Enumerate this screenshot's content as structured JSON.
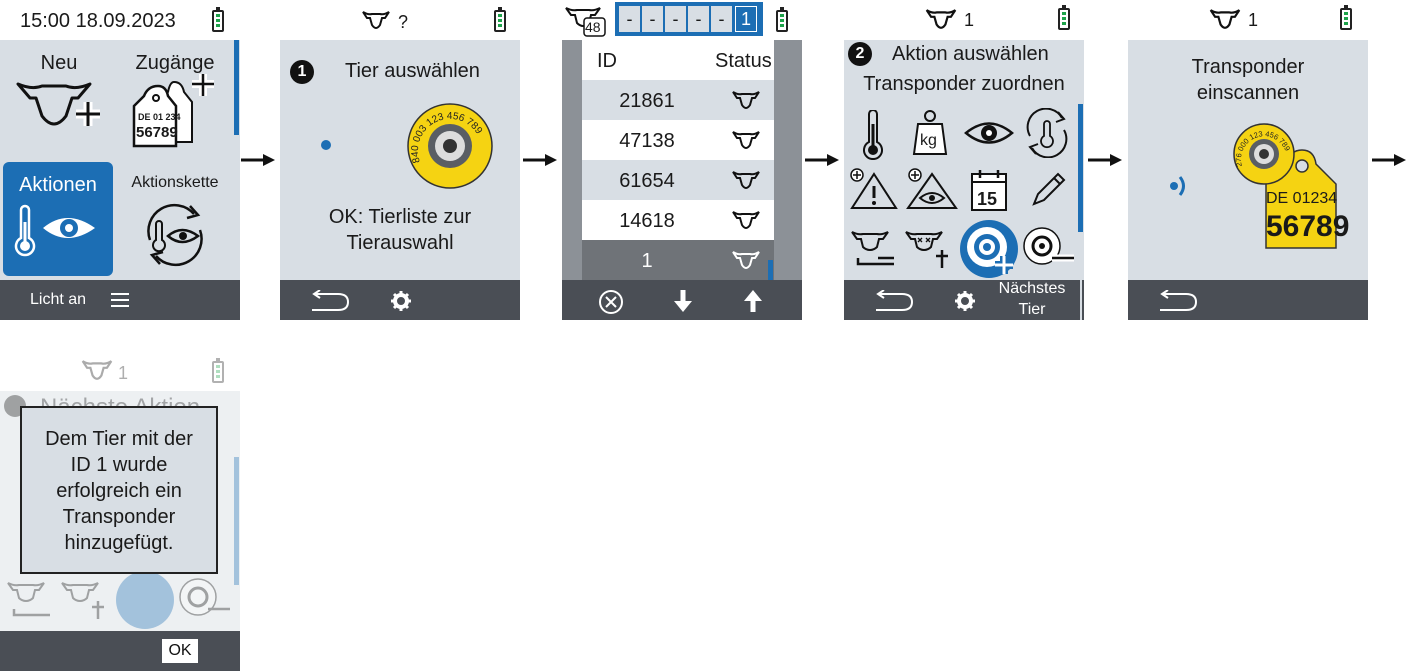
{
  "screen1": {
    "datetime": "15:00 18.09.2023",
    "neu": "Neu",
    "zugaenge": "Zugänge",
    "tag_line1": "DE 01 234",
    "tag_line2": "56789",
    "aktionen": "Aktionen",
    "aktionskette": "Aktionskette",
    "footer_label": "Licht an"
  },
  "screen2": {
    "animal_id": "?",
    "step": "1",
    "title": "Tier auswählen",
    "tag_number": "840 003 123 456 789",
    "hint_line1": "OK: Tierliste zur",
    "hint_line2": "Tierauswahl"
  },
  "screen3": {
    "count": "48",
    "id_digits": [
      "-",
      "-",
      "-",
      "-",
      "-",
      "1"
    ],
    "col_id": "ID",
    "col_status": "Status",
    "rows": [
      "21861",
      "47138",
      "61654",
      "14618",
      "1"
    ]
  },
  "screen4": {
    "animal_id": "1",
    "step": "2",
    "title": "Aktion auswählen",
    "subtitle": "Transponder zuordnen",
    "kg": "kg",
    "calendar_day": "15",
    "footer_next_line1": "Nächstes",
    "footer_next_line2": "Tier"
  },
  "screen5": {
    "animal_id": "1",
    "title_line1": "Transponder",
    "title_line2": "einscannen",
    "tag_number": "276 000 123 456 789",
    "ear_tag_line1": "DE 01234",
    "ear_tag_line2": "56789"
  },
  "screen6": {
    "animal_id": "1",
    "bg_title": "Nächste Aktion",
    "msg_line1": "Dem Tier mit der",
    "msg_line2": "ID 1 wurde",
    "msg_line3": "erfolgreich ein",
    "msg_line4": "Transponder",
    "msg_line5": "hinzugefügt.",
    "ok": "OK"
  },
  "colors": {
    "accent": "#1c6eb4",
    "panel": "#d8dee4",
    "footer": "#4a4e55",
    "tag_yellow": "#f5d312",
    "battery": "#1ea34a"
  }
}
